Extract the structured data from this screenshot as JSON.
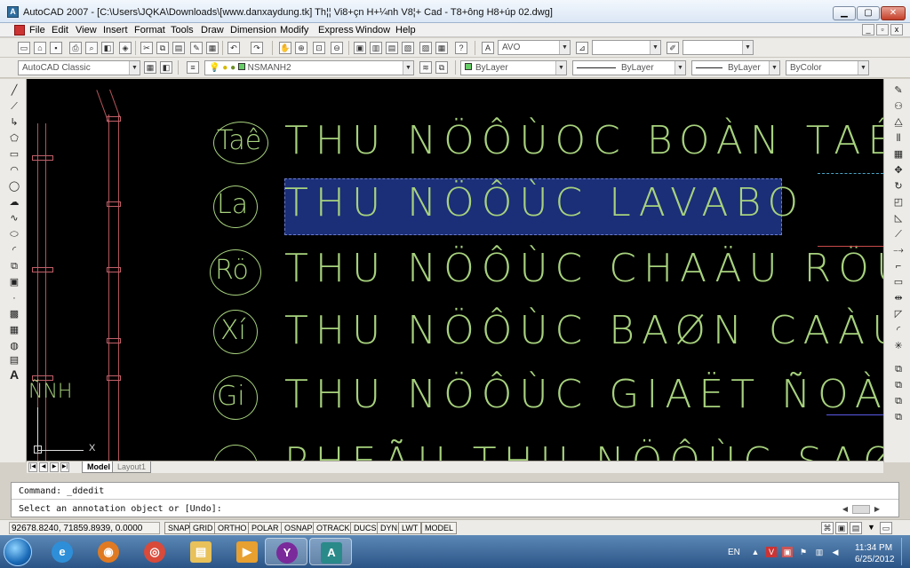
{
  "window": {
    "title": "AutoCAD 2007 - [C:\\Users\\JQKA\\Downloads\\[www.danxaydung.tk] Th¦¦ Vi8+çn H+¼nh V8¦+ Cad - T8+ông H8+úp 02.dwg]",
    "app_icon_label": "A"
  },
  "menu": {
    "items": [
      "File",
      "Edit",
      "View",
      "Insert",
      "Format",
      "Tools",
      "Draw",
      "Dimension",
      "Modify",
      "Express",
      "Window",
      "Help"
    ]
  },
  "toolbars": {
    "text_style": "AVO",
    "workspace": "AutoCAD Classic",
    "layer": "NSMANH2",
    "color": "ByLayer",
    "linetype": "ByLayer",
    "lineweight": "ByLayer",
    "plot_style": "ByColor"
  },
  "drawing": {
    "rows": [
      {
        "circle": "Taê",
        "text": "THU NÖÔÙOC BOÀN TAÉ"
      },
      {
        "circle": "La",
        "text": "THU NÖÔÙC LAVABO"
      },
      {
        "circle": "Rö",
        "text": "THU NÖÔÙC CHAÄU RÖÛ"
      },
      {
        "circle": "Xí",
        "text": "THU NÖÔÙC BAØN CAÀU"
      },
      {
        "circle": "Gi",
        "text": "THU NÖÔÙC GIAËT ÑOÀ"
      },
      {
        "circle": "",
        "text": "PHEÃU THU NÖÔÙC SAØ"
      }
    ],
    "left_label": "ÑNH",
    "ucs_x": "X"
  },
  "layout_tabs": [
    "Model",
    "Layout1"
  ],
  "command": {
    "line1": "Command: _ddedit",
    "line2": "Select an annotation object or [Undo]:"
  },
  "status": {
    "coords": "92678.8240, 71859.8939, 0.0000",
    "buttons": [
      "SNAP",
      "GRID",
      "ORTHO",
      "POLAR",
      "OSNAP",
      "OTRACK",
      "DUCS",
      "DYN",
      "LWT",
      "MODEL"
    ]
  },
  "taskbar": {
    "lang": "EN",
    "time": "11:34 PM",
    "date": "6/25/2012"
  }
}
